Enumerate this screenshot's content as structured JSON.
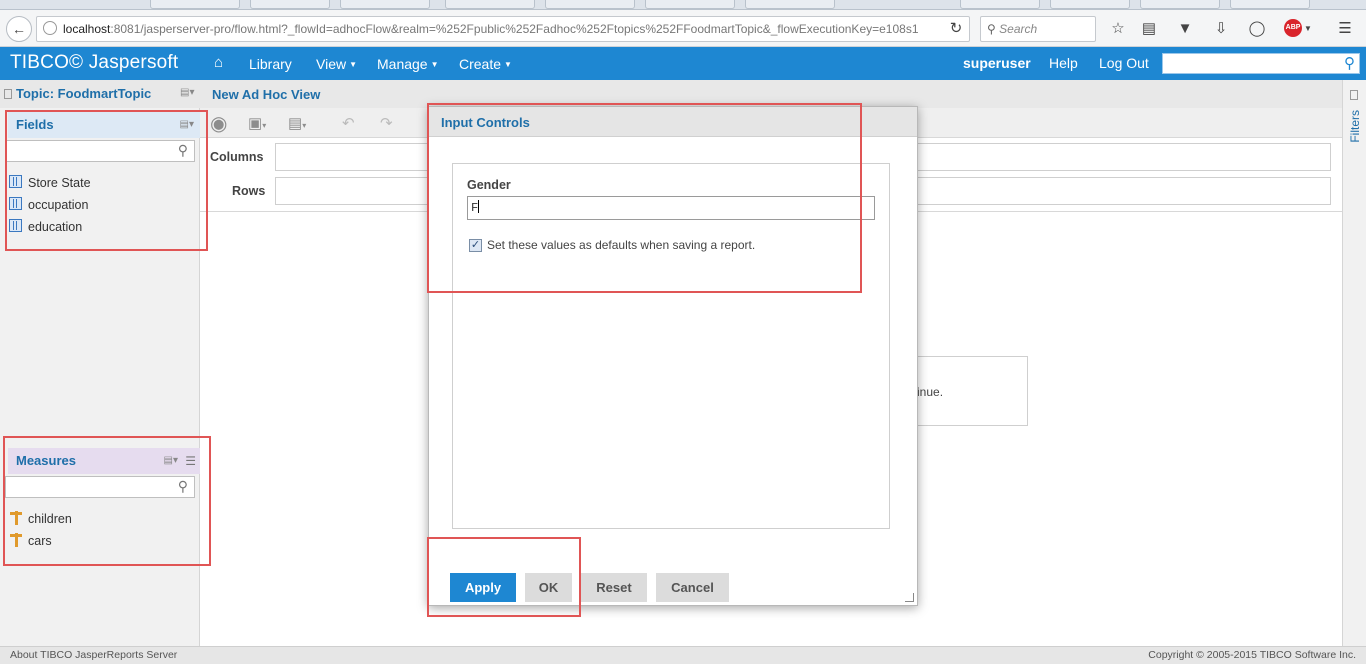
{
  "browser": {
    "url_host": "localhost",
    "url_rest": ":8081/jasperserver-pro/flow.html?_flowId=adhocFlow&realm=%252Fpublic%252Fadhoc%252Ftopics%252FFoodmartTopic&_flowExecutionKey=e108s1",
    "search_placeholder": "Search",
    "abp_label": "ABP"
  },
  "header": {
    "logo": "TIBCO© Jaspersoft",
    "menu": {
      "library": "Library",
      "view": "View",
      "manage": "Manage",
      "create": "Create"
    },
    "user": "superuser",
    "help": "Help",
    "logout": "Log Out"
  },
  "left_panel": {
    "topic_title": "Topic: FoodmartTopic",
    "fields_title": "Fields",
    "fields": [
      "Store State",
      "occupation",
      "education"
    ],
    "measures_title": "Measures",
    "measures": [
      "children",
      "cars"
    ]
  },
  "main": {
    "view_title": "New Ad Hoc View",
    "columns_label": "Columns",
    "rows_label": "Rows",
    "message_fragment": "inue."
  },
  "filters_label": "Filters",
  "dialog": {
    "title": "Input Controls",
    "gender_label": "Gender",
    "gender_value": "F",
    "defaults_checkbox_label": "Set these values as defaults when saving a report.",
    "defaults_checked": true,
    "buttons": {
      "apply": "Apply",
      "ok": "OK",
      "reset": "Reset",
      "cancel": "Cancel"
    }
  },
  "footer": {
    "about": "About TIBCO JasperReports Server",
    "copyright": "Copyright © 2005-2015 TIBCO Software Inc."
  },
  "colors": {
    "brand": "#1e87d2",
    "annotation": "#e05555",
    "heading": "#1f6fa9"
  }
}
